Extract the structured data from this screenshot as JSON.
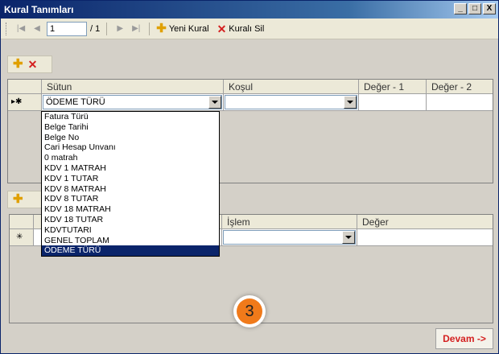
{
  "window": {
    "title": "Kural Tanımları",
    "minimize": "_",
    "maximize": "□",
    "close": "X"
  },
  "nav_toolbar": {
    "first_icon": "first-page-icon",
    "prev_icon": "previous-page-icon",
    "page_value": "1",
    "page_total": "/ 1",
    "next_icon": "next-page-icon",
    "last_icon": "last-page-icon",
    "new_rule_label": "Yeni Kural",
    "delete_rule_label": "Kuralı Sil"
  },
  "rules_grid": {
    "columns": [
      "Sütun",
      "Koşul",
      "Değer - 1",
      "Değer - 2"
    ],
    "row_marker": "▸✱",
    "sutun_value": "ÖDEME TÜRÜ"
  },
  "dropdown": {
    "options": [
      "Fatura Türü",
      "Belge Tarihi",
      "Belge No",
      "Cari Hesap Unvanı",
      "0 matrah",
      "KDV 1 MATRAH",
      "KDV 1 TUTAR",
      "KDV 8 MATRAH",
      "KDV 8 TUTAR",
      "KDV 18 MATRAH",
      "KDV 18 TUTAR",
      "KDVTUTARI",
      "GENEL TOPLAM",
      "ÖDEME TÜRÜ"
    ],
    "selected": "ÖDEME TÜRÜ"
  },
  "actions_grid": {
    "columns": [
      "İşlem",
      "Değer"
    ],
    "row_marker": "✳"
  },
  "step_badge": "3",
  "devam_label": "Devam ->",
  "colors": {
    "title_bar": "#0a246a",
    "selection": "#0a246a",
    "accent_red": "#d42020",
    "badge_orange": "#f07a1a"
  }
}
